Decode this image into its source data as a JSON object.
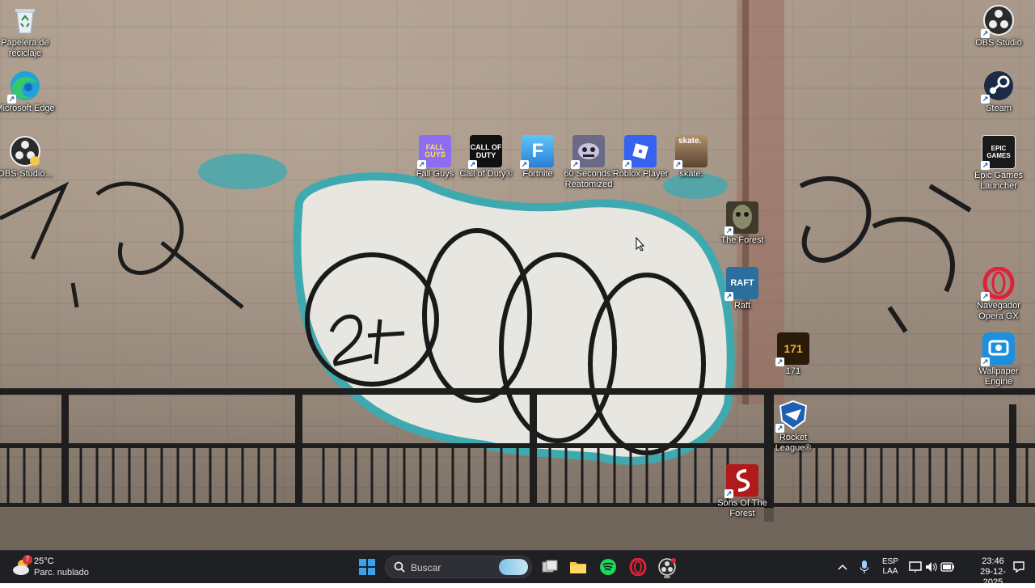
{
  "desktop": {
    "icons": [
      {
        "label": "Papelera de reciclaje",
        "icon": "recycle-bin-icon",
        "color": "#dfe8f0"
      },
      {
        "label": "Microsoft Edge",
        "icon": "edge-icon",
        "color": "#1fa3d6"
      },
      {
        "label": "OBS-Studio...",
        "icon": "obs-icon",
        "color": "#2b2b2b"
      },
      {
        "label": "Fall Guys",
        "icon": "fall-guys-icon",
        "color": "#8d6df2"
      },
      {
        "label": "Call of Duty®",
        "icon": "call-of-duty-icon",
        "color": "#111111"
      },
      {
        "label": "Fortnite",
        "icon": "fortnite-icon",
        "color": "#3aa9f0"
      },
      {
        "label": "60 Seconds! Reatomized",
        "icon": "60-seconds-icon",
        "color": "#6a6a86"
      },
      {
        "label": "Roblox Player",
        "icon": "roblox-icon",
        "color": "#3562f0"
      },
      {
        "label": "skate.",
        "icon": "skate-icon",
        "color": "#8a6a4a"
      },
      {
        "label": "The Forest",
        "icon": "the-forest-icon",
        "color": "#3e3b2a"
      },
      {
        "label": "Raft",
        "icon": "raft-icon",
        "color": "#2a6f9e"
      },
      {
        "label": "171",
        "icon": "171-icon",
        "color": "#2a1a0a"
      },
      {
        "label": "Rocket League®",
        "icon": "rocket-league-icon",
        "color": "#1d5fb5"
      },
      {
        "label": "Sons Of The Forest",
        "icon": "sons-of-the-forest-icon",
        "color": "#b01a1a"
      },
      {
        "label": "OBS Studio",
        "icon": "obs-icon",
        "color": "#2b2b2b"
      },
      {
        "label": "Steam",
        "icon": "steam-icon",
        "color": "#1b2b45"
      },
      {
        "label": "Epic Games Launcher",
        "icon": "epic-games-icon",
        "color": "#1a1a1a"
      },
      {
        "label": "Navegador Opera GX",
        "icon": "opera-gx-icon",
        "color": "#e0213a"
      },
      {
        "label": "Wallpaper Engine",
        "icon": "wallpaper-engine-icon",
        "color": "#1d8fe0"
      }
    ],
    "small_text": {
      "fall_guys": "FALL GUYS",
      "cod": "CALL OF DUTY",
      "fortnite": "F",
      "skate": "skate.",
      "raft": "RAFT",
      "num171": "171",
      "epic": "EPIC GAMES"
    }
  },
  "taskbar": {
    "weather": {
      "temp": "25°C",
      "condition": "Parc. nublado",
      "badge": "7"
    },
    "search": {
      "placeholder": "Buscar"
    },
    "pinned": [
      "start-icon",
      "search-icon",
      "task-view-icon",
      "file-explorer-icon",
      "spotify-icon",
      "opera-gx-icon",
      "obs-icon"
    ],
    "tray": {
      "lang_line1": "ESP",
      "lang_line2": "LAA",
      "time": "23:46",
      "date": "29-12-2025"
    }
  },
  "colors": {
    "taskbar_bg": "#1f2023",
    "accent_blue": "#3aa0f0"
  }
}
